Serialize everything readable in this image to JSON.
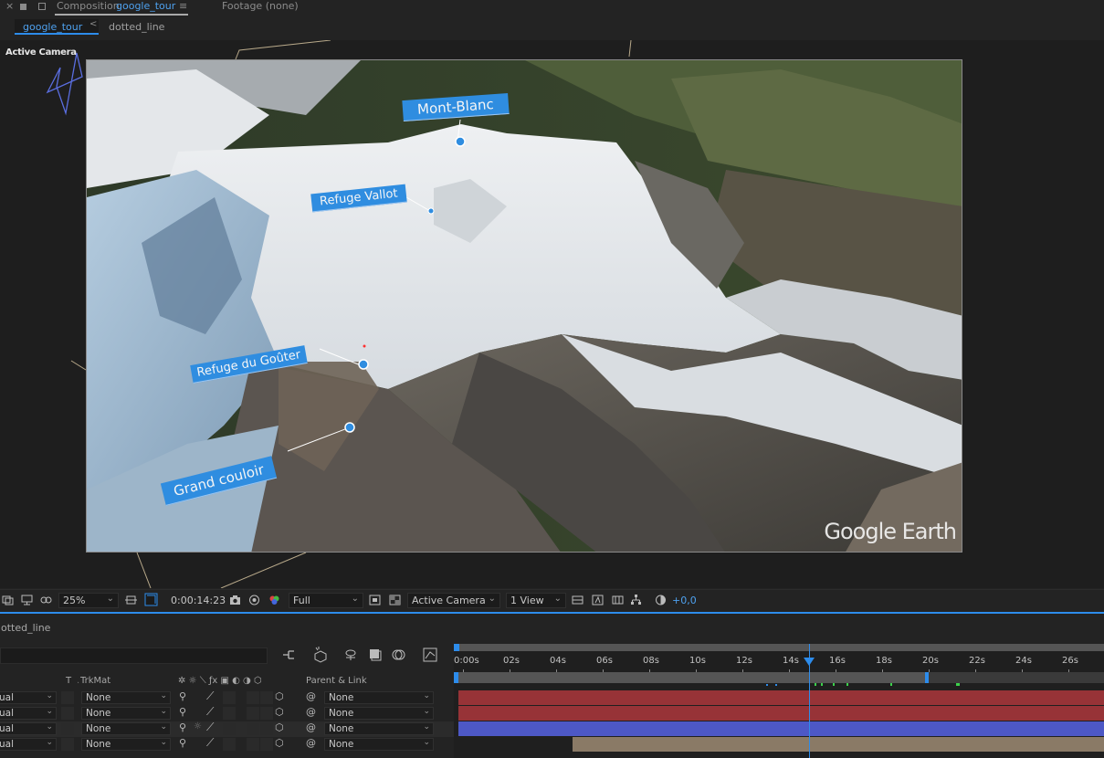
{
  "panel_header": {
    "close": "×",
    "panel_name": "Composition",
    "comp_name": "google_tour",
    "menu": "≡",
    "footage": "Footage (none)"
  },
  "tabs": {
    "active": "google_tour",
    "chevron": "<",
    "other": "dotted_line"
  },
  "viewer": {
    "camera_label": "Active Camera",
    "labels": {
      "mont_blanc": "Mont-Blanc",
      "refuge_vallot": "Refuge Vallot",
      "refuge_gouter": "Refuge du Goûter",
      "grand_couloir": "Grand couloir"
    },
    "logo": "Google Earth"
  },
  "toolbar": {
    "zoom": "25%",
    "timecode": "0:00:14:23",
    "resolution": "Full",
    "view_camera": "Active Camera",
    "view_layout": "1 View",
    "exposure": "+0,0"
  },
  "timeline": {
    "tab_name": "dotted_line",
    "ruler": [
      "0:00s",
      "02s",
      "04s",
      "06s",
      "08s",
      "10s",
      "12s",
      "14s",
      "16s",
      "18s",
      "20s",
      "22s",
      "24s",
      "26s"
    ],
    "current_time_seconds": 14.9,
    "work_area_end_seconds": 20.3,
    "columns": {
      "t": "T",
      "trkmat": "TrkMat",
      "parent": "Parent & Link"
    },
    "layers": [
      {
        "mode": "ual",
        "trkmat": "None",
        "parent": "None",
        "bar_color": "#973337"
      },
      {
        "mode": "ual",
        "trkmat": "None",
        "parent": "None",
        "bar_color": "#973337"
      },
      {
        "mode": "ual",
        "trkmat": "None",
        "parent": "None",
        "bar_color": "#4d58c6"
      },
      {
        "mode": "ual",
        "trkmat": "None",
        "parent": "None",
        "bar_color": "#8a7a66"
      }
    ]
  },
  "colors": {
    "accent": "#2d8ceb",
    "label_blue": "#2f8de0"
  }
}
